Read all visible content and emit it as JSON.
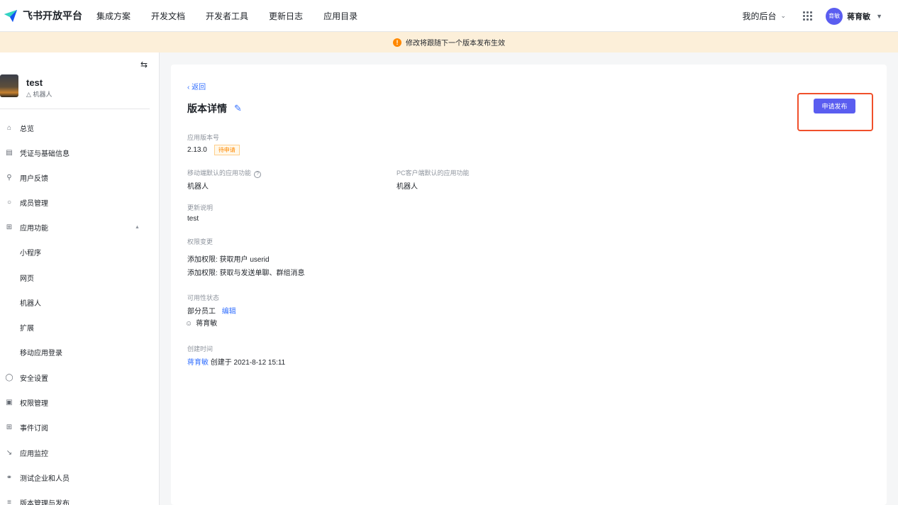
{
  "header": {
    "brand": "飞书开放平台",
    "nav": [
      "集成方案",
      "开发文档",
      "开发者工具",
      "更新日志",
      "应用目录"
    ],
    "backstage": "我的后台",
    "avatar_text": "育敏",
    "username": "蒋育敏"
  },
  "banner": {
    "message": "修改将跟随下一个版本发布生效",
    "icon": "warning-icon",
    "color": "#fcefd9"
  },
  "sidebar": {
    "app_name": "test",
    "app_type": "机器人",
    "items": [
      {
        "label": "总览",
        "icon": "home-icon"
      },
      {
        "label": "凭证与基础信息",
        "icon": "credential-icon"
      },
      {
        "label": "用户反馈",
        "icon": "feedback-icon"
      },
      {
        "label": "成员管理",
        "icon": "member-icon"
      },
      {
        "label": "应用功能",
        "icon": "grid-icon"
      },
      {
        "label": "小程序",
        "icon": ""
      },
      {
        "label": "网页",
        "icon": ""
      },
      {
        "label": "机器人",
        "icon": ""
      },
      {
        "label": "扩展",
        "icon": ""
      },
      {
        "label": "移动应用登录",
        "icon": ""
      },
      {
        "label": "安全设置",
        "icon": "shield-icon"
      },
      {
        "label": "权限管理",
        "icon": "lock-icon"
      },
      {
        "label": "事件订阅",
        "icon": "event-icon"
      },
      {
        "label": "应用监控",
        "icon": "chart-icon"
      },
      {
        "label": "测试企业和人员",
        "icon": "team-icon"
      },
      {
        "label": "版本管理与发布",
        "icon": "layers-icon"
      }
    ]
  },
  "main": {
    "back": "返回",
    "title": "版本详情",
    "publish_button": "申请发布",
    "version_label": "应用版本号",
    "version": "2.13.0",
    "status": "待申请",
    "mobile_default_label": "移动端默认的应用功能",
    "mobile_default_value": "机器人",
    "pc_default_label": "PC客户端默认的应用功能",
    "pc_default_value": "机器人",
    "update_notes_label": "更新说明",
    "update_notes": "test",
    "permission_changes_label": "权限变更",
    "permission_changes": [
      "添加权限: 获取用户 userid",
      "添加权限: 获取与发送单聊、群组消息"
    ],
    "availability_label": "可用性状态",
    "availability_value": "部分员工",
    "availability_edit": "编辑",
    "availability_member": "蒋育敏",
    "created_label": "创建时间",
    "created_by": "蒋育敏",
    "created_text": "创建于 2021-8-12 15:11"
  },
  "colors": {
    "accent": "#5a5df0",
    "link": "#3370ff",
    "highlight": "#f0502b",
    "status": "#ff8800"
  }
}
